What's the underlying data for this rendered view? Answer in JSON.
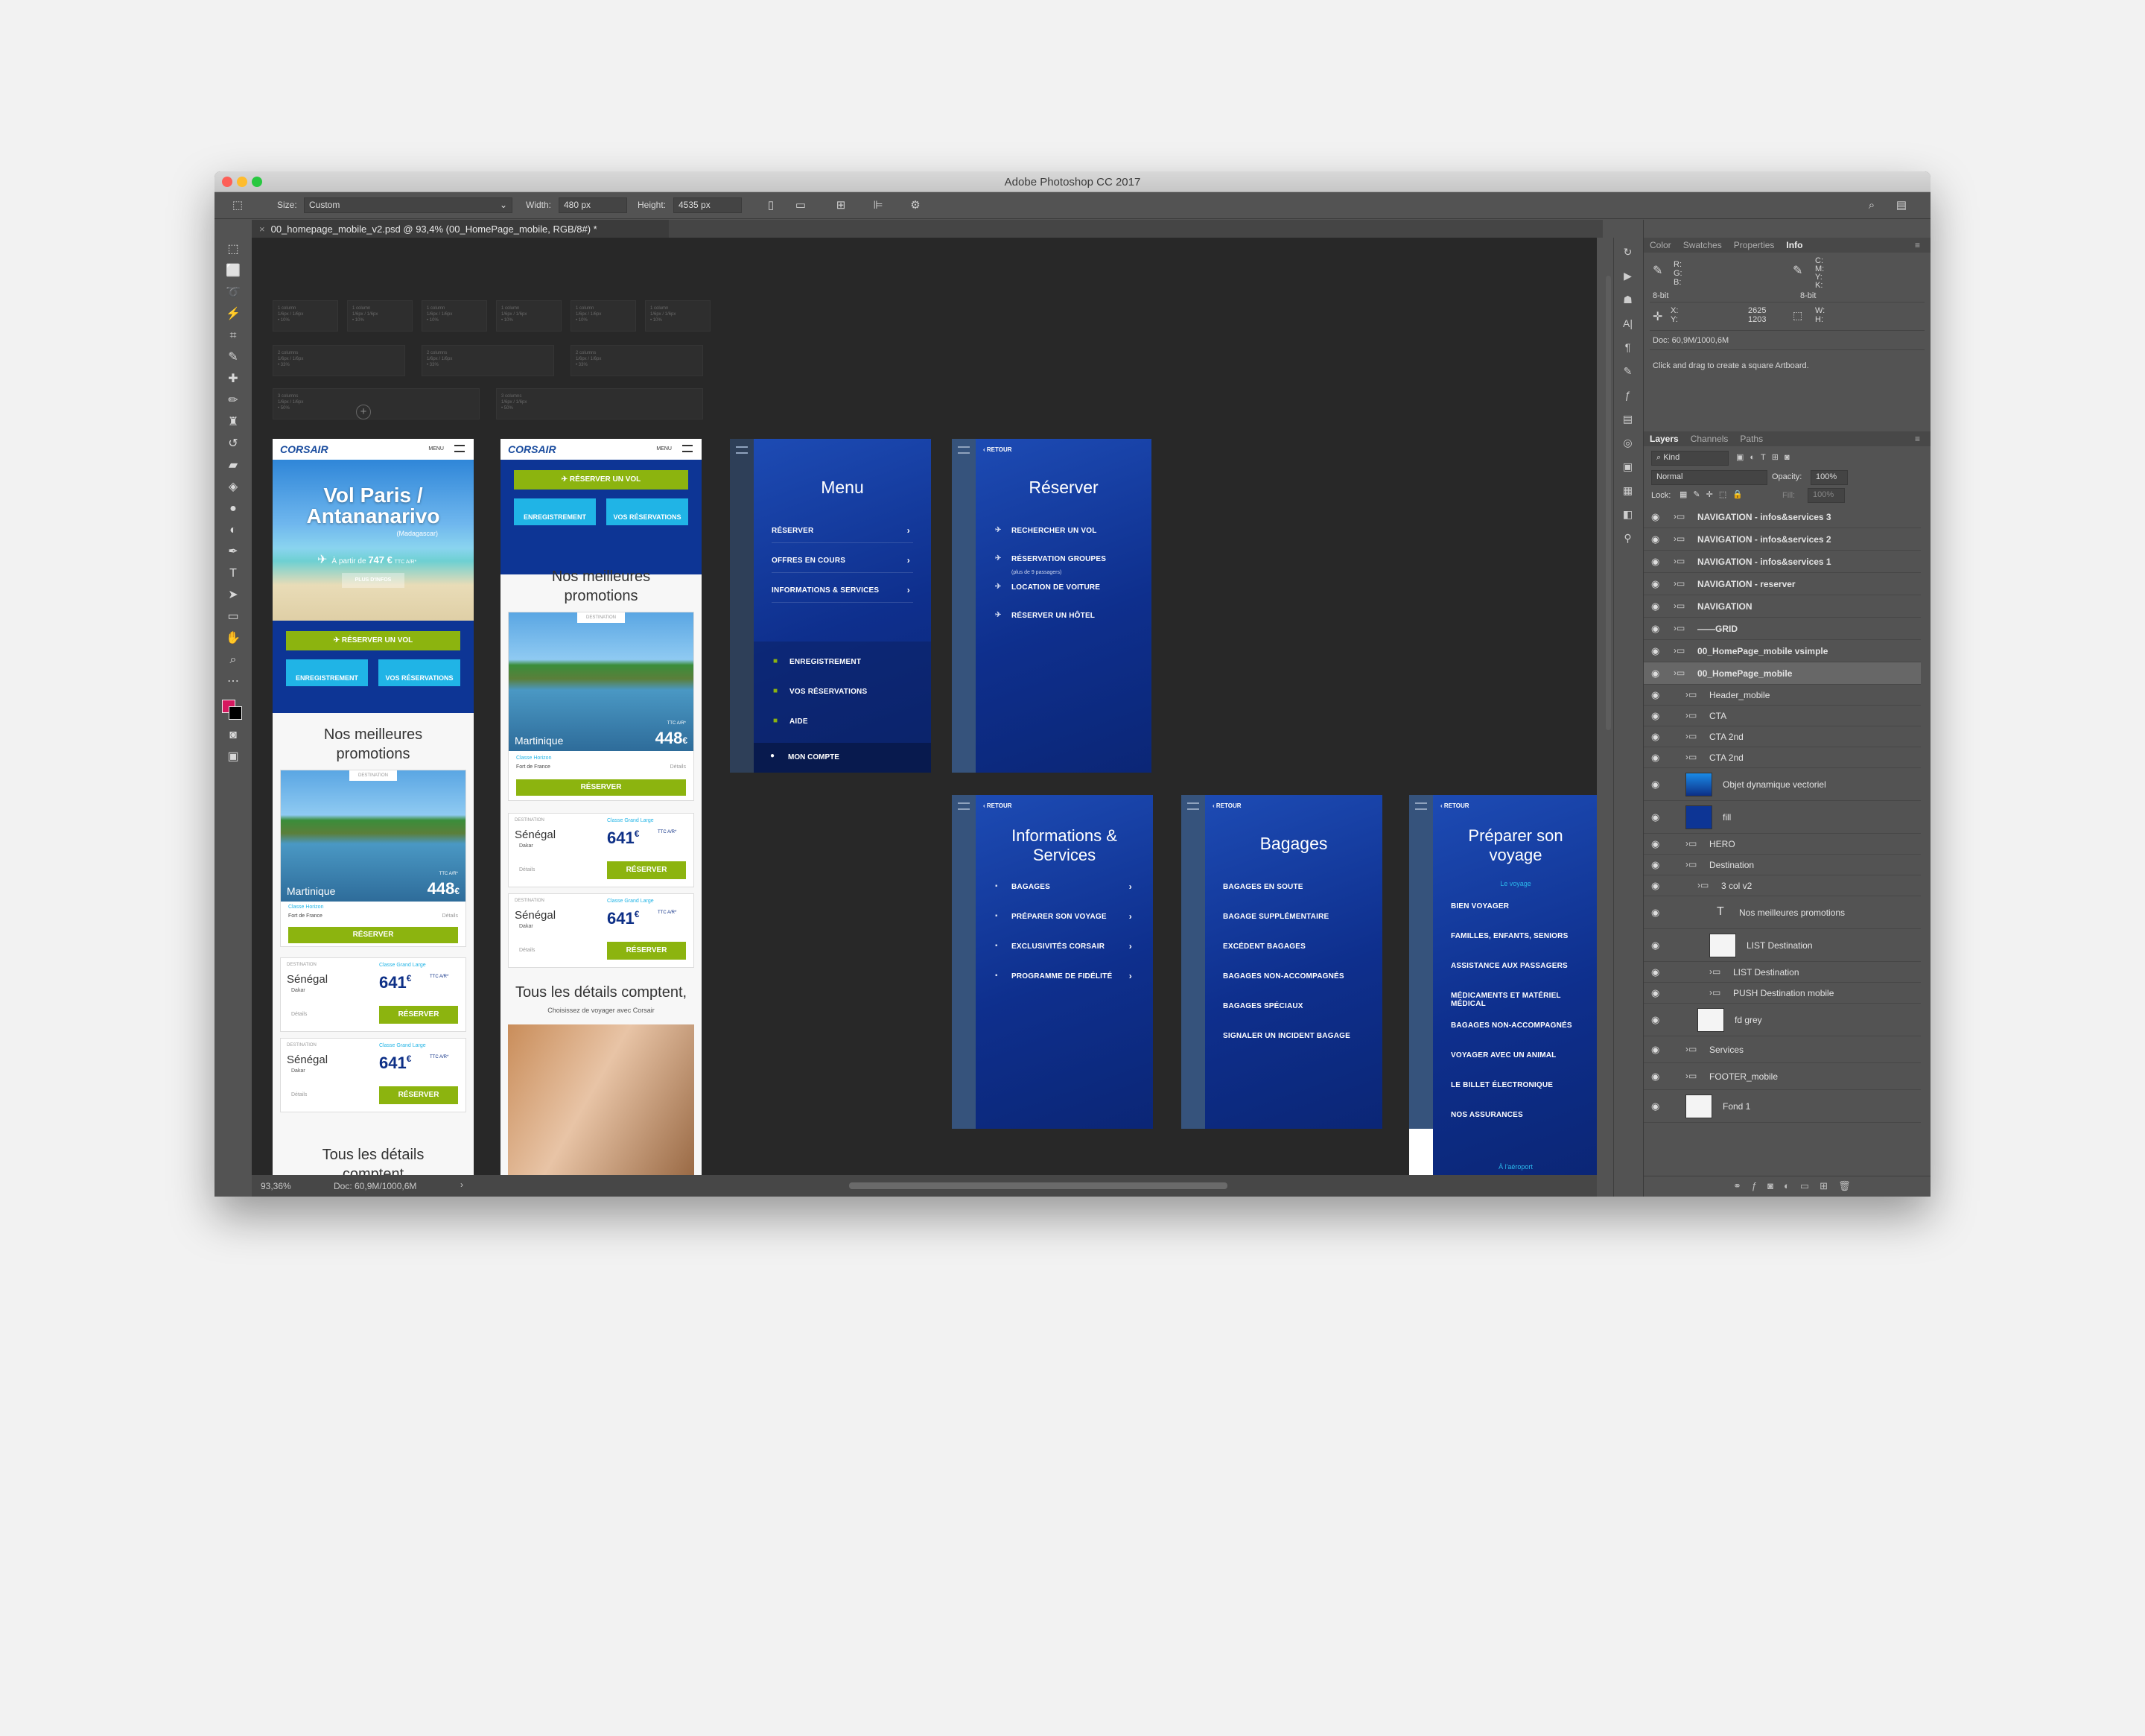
{
  "window": {
    "title": "Adobe Photoshop CC 2017"
  },
  "options": {
    "size_label": "Size:",
    "size_value": "Custom",
    "width_label": "Width:",
    "width_value": "480 px",
    "height_label": "Height:",
    "height_value": "4535 px"
  },
  "document_tab": "00_homepage_mobile_v2.psd @ 93,4% (00_HomePage_mobile, RGB/8#) *",
  "status": {
    "zoom": "93,36%",
    "doc": "Doc: 60,9M/1000,6M"
  },
  "info_panel": {
    "tabs": [
      "Color",
      "Swatches",
      "Properties",
      "Info"
    ],
    "active_tab": "Info",
    "rgb_labels": "R:\nG:\nB:",
    "bit_left": "8-bit",
    "cmyk_labels": "C:\nM:\nY:\nK:",
    "bit_right": "8-bit",
    "xy_labels": "X:\nY:",
    "x_value": "2625",
    "y_value": "1203",
    "wh_labels": "W:\nH:",
    "doc": "Doc: 60,9M/1000,6M",
    "hint": "Click and drag to create a square Artboard."
  },
  "layers_panel": {
    "tabs": [
      "Layers",
      "Channels",
      "Paths"
    ],
    "kind": "Kind",
    "blend": "Normal",
    "opacity_label": "Opacity:",
    "opacity": "100%",
    "lock_label": "Lock:",
    "fill_label": "Fill:",
    "fill": "100%",
    "layers": [
      "NAVIGATION - infos&services 3",
      "NAVIGATION - infos&services 2",
      "NAVIGATION - infos&services 1",
      "NAVIGATION - reserver",
      "NAVIGATION",
      "——GRID",
      "00_HomePage_mobile vsimple",
      "00_HomePage_mobile",
      "Header_mobile",
      "CTA",
      "CTA 2nd",
      "CTA 2nd",
      "Objet dynamique vectoriel",
      "fill",
      "HERO",
      "Destination",
      "3 col v2",
      "Nos meilleures promotions",
      "LIST Destination",
      "LIST Destination",
      "PUSH Destination mobile",
      "fd grey",
      "Services",
      "FOOTER_mobile",
      "Fond 1"
    ]
  },
  "grid_labels": [
    "1 column\n1/6px / 1/6px\n• 10%",
    "1 column\n1/6px / 1/6px\n• 10%",
    "1 column\n1/6px / 1/6px\n• 10%",
    "1 column\n1/6px / 1/6px\n• 10%",
    "1 column\n1/6px / 1/6px\n• 10%",
    "1 column\n1/6px / 1/6px\n• 10%",
    "2 columns\n1/6px / 1/6px\n• 33%",
    "2 columns\n1/6px / 1/6px\n• 33%",
    "2 columns\n1/6px / 1/6px\n• 33%",
    "3 columns\n1/6px / 1/6px\n• 50%",
    "3 columns\n1/6px / 1/6px\n• 50%"
  ],
  "home1": {
    "logo": "CORSAIR",
    "menu": "MENU",
    "hero_title": "Vol Paris / Antananarivo",
    "hero_sub": "(Madagascar)",
    "hero_price_prefix": "À partir de",
    "hero_price": "747 €",
    "hero_price_suffix": "TTC A/R*",
    "hero_btn": "PLUS D'INFOS",
    "cta_reserve": "RÉSERVER UN VOL",
    "cta_enreg": "ENREGISTREMENT",
    "cta_resa": "VOS RÉSERVATIONS",
    "promo_title": "Nos meilleures promotions",
    "dest_tag": "DESTINATION",
    "dest_name": "Martinique",
    "dest_price": "448",
    "dest_currency": "€",
    "dest_ttc": "TTC A/R*",
    "cabin": "Classe Horizon",
    "city": "Fort de France",
    "details": "Détails",
    "reserve": "RÉSERVER",
    "list": [
      {
        "tag": "DESTINATION",
        "cabin": "Classe Grand Large",
        "name": "Sénégal",
        "city": "Dakar",
        "price": "641",
        "currency": "€",
        "ttc": "TTC A/R*",
        "details": "Détails",
        "btn": "RÉSERVER"
      },
      {
        "tag": "DESTINATION",
        "cabin": "Classe Grand Large",
        "name": "Sénégal",
        "city": "Dakar",
        "price": "641",
        "currency": "€",
        "ttc": "TTC A/R*",
        "details": "Détails",
        "btn": "RÉSERVER"
      }
    ],
    "footer_title": "Tous les détails comptent"
  },
  "home2": {
    "logo": "CORSAIR",
    "menu": "MENU",
    "cta_reserve": "RÉSERVER UN VOL",
    "cta_enreg": "ENREGISTREMENT",
    "cta_resa": "VOS RÉSERVATIONS",
    "promo_title": "Nos meilleures promotions",
    "dest_tag": "DESTINATION",
    "dest_name": "Martinique",
    "dest_price": "448",
    "dest_currency": "€",
    "dest_ttc": "TTC A/R*",
    "cabin": "Classe Horizon",
    "city": "Fort de France",
    "details": "Détails",
    "reserve": "RÉSERVER",
    "list": [
      {
        "tag": "DESTINATION",
        "cabin": "Classe Grand Large",
        "name": "Sénégal",
        "city": "Dakar",
        "price": "641",
        "currency": "€",
        "ttc": "TTC A/R*",
        "details": "Détails",
        "btn": "RÉSERVER"
      },
      {
        "tag": "DESTINATION",
        "cabin": "Classe Grand Large",
        "name": "Sénégal",
        "city": "Dakar",
        "price": "641",
        "currency": "€",
        "ttc": "TTC A/R*",
        "details": "Détails",
        "btn": "RÉSERVER"
      }
    ],
    "footer_title": "Tous les détails comptent,",
    "footer_sub": "Choisissez de voyager avec Corsair"
  },
  "menu_ab": {
    "title": "Menu",
    "items": [
      "RÉSERVER",
      "OFFRES EN COURS",
      "INFORMATIONS & SERVICES"
    ],
    "sub": [
      "ENREGISTREMENT",
      "VOS RÉSERVATIONS",
      "AIDE"
    ],
    "account": "MON COMPTE"
  },
  "reserver_ab": {
    "retour": "RETOUR",
    "title": "Réserver",
    "items": [
      "RECHERCHER UN VOL",
      "RÉSERVATION GROUPES",
      "LOCATION DE VOITURE",
      "RÉSERVER UN HÔTEL"
    ],
    "groups_note": "(plus de 9 passagers)"
  },
  "infos_ab": {
    "retour": "RETOUR",
    "title": "Informations & Services",
    "items": [
      "BAGAGES",
      "PRÉPARER SON VOYAGE",
      "EXCLUSIVITÉS CORSAIR",
      "PROGRAMME DE FIDÉLITÉ"
    ]
  },
  "bagages_ab": {
    "retour": "RETOUR",
    "title": "Bagages",
    "items": [
      "BAGAGES EN SOUTE",
      "BAGAGE SUPPLÉMENTAIRE",
      "EXCÉDENT BAGAGES",
      "BAGAGES NON-ACCOMPAGNÉS",
      "BAGAGES SPÉCIAUX",
      "SIGNALER UN INCIDENT BAGAGE"
    ]
  },
  "preparer_ab": {
    "retour": "RETOUR",
    "title": "Préparer son voyage",
    "section": "Le voyage",
    "items": [
      "BIEN VOYAGER",
      "FAMILLES, ENFANTS, SENIORS",
      "ASSISTANCE AUX PASSAGERS",
      "MÉDICAMENTS ET MATÉRIEL MÉDICAL",
      "BAGAGES NON-ACCOMPAGNÉS",
      "VOYAGER AVEC UN ANIMAL",
      "LE BILLET ÉLECTRONIQUE",
      "NOS ASSURANCES"
    ],
    "bottom": "À l'aéroport"
  },
  "colors": {
    "brand_blue": "#0e2f8d",
    "green": "#8cb40f",
    "cyan": "#20b4e6",
    "photoshop_bg": "#535353",
    "canvas": "#282828"
  }
}
